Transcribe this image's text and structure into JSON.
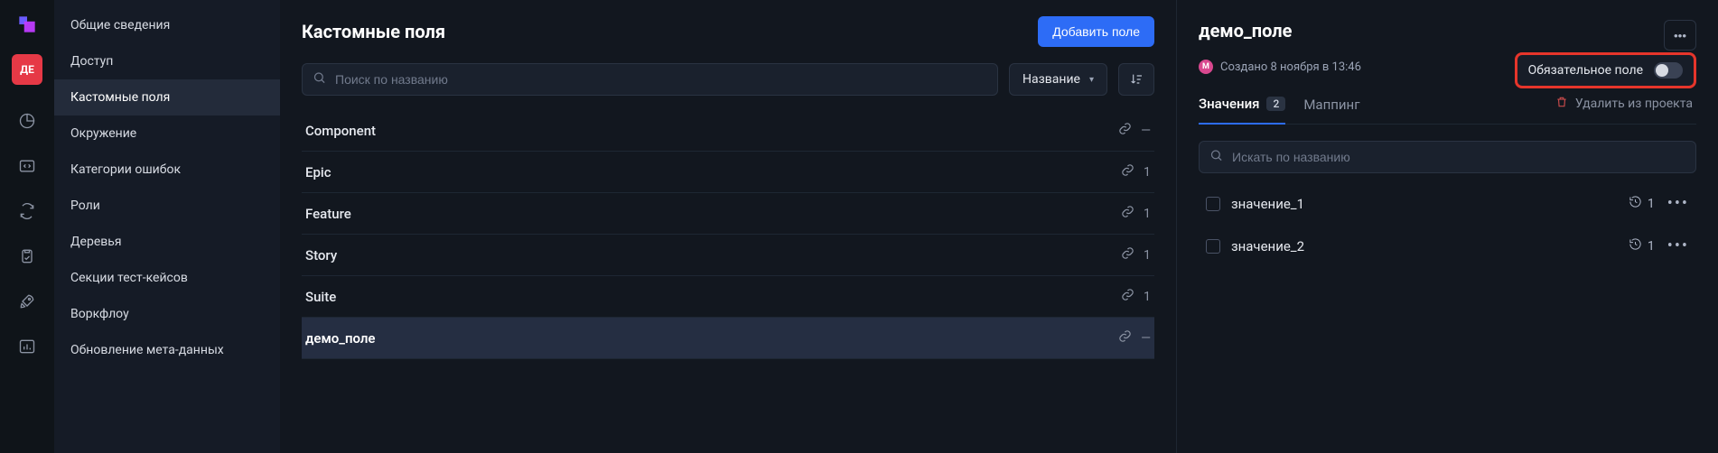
{
  "rail": {
    "avatar_label": "ДЕ"
  },
  "sidebar": {
    "items": [
      {
        "label": "Общие сведения"
      },
      {
        "label": "Доступ"
      },
      {
        "label": "Кастомные поля"
      },
      {
        "label": "Окружение"
      },
      {
        "label": "Категории ошибок"
      },
      {
        "label": "Роли"
      },
      {
        "label": "Деревья"
      },
      {
        "label": "Секции тест-кейсов"
      },
      {
        "label": "Воркфлоу"
      },
      {
        "label": "Обновление мета-данных"
      }
    ],
    "active_index": 2
  },
  "main": {
    "title": "Кастомные поля",
    "add_button": "Добавить поле",
    "search_placeholder": "Поиск по названию",
    "sort_label": "Название",
    "rows": [
      {
        "name": "Component",
        "count": "—"
      },
      {
        "name": "Epic",
        "count": "1"
      },
      {
        "name": "Feature",
        "count": "1"
      },
      {
        "name": "Story",
        "count": "1"
      },
      {
        "name": "Suite",
        "count": "1"
      },
      {
        "name": "демо_поле",
        "count": "—"
      }
    ],
    "selected_index": 5
  },
  "detail": {
    "title": "демо_поле",
    "meta_badge": "M",
    "meta_text": "Создано 8 ноября в 13:46",
    "required_label": "Обязательное поле",
    "delete_label": "Удалить из проекта",
    "tabs": [
      {
        "label": "Значения",
        "badge": "2"
      },
      {
        "label": "Маппинг"
      }
    ],
    "active_tab": 0,
    "search_placeholder": "Искать по названию",
    "values": [
      {
        "name": "значение_1",
        "count": "1"
      },
      {
        "name": "значение_2",
        "count": "1"
      }
    ]
  }
}
